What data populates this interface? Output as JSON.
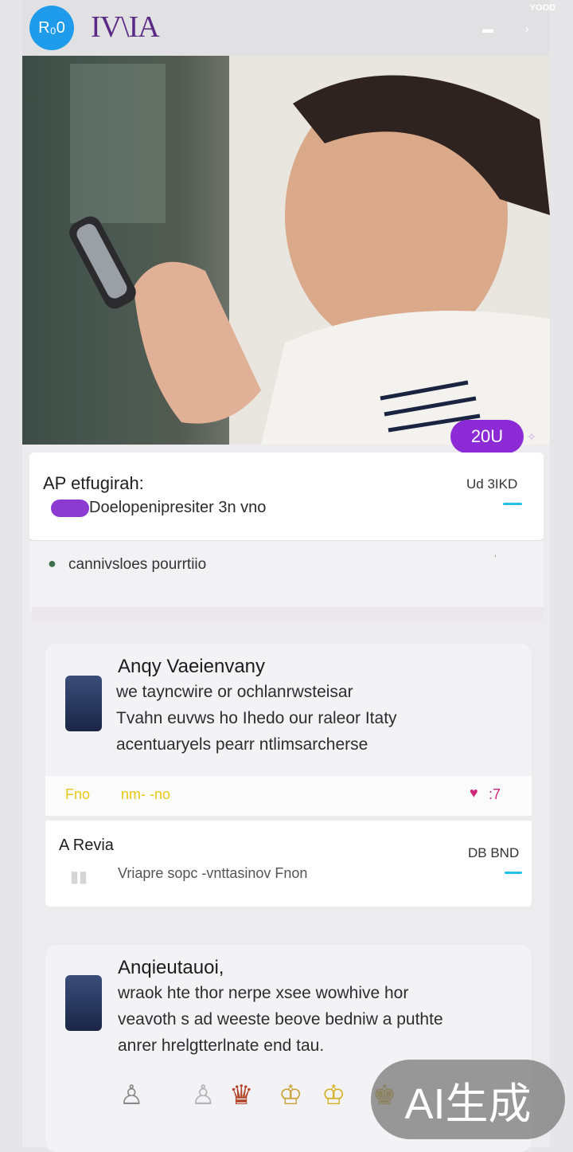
{
  "header": {
    "avatar_text": "R₀0",
    "brand": "IV\\IA",
    "status_right": "YOOD"
  },
  "hero": {
    "badge": "20U"
  },
  "card_one": {
    "title": "AP  etfugirah:",
    "subtitle": "Doelopenipresiter 3n vno",
    "right_label": "Ud 3IKD",
    "detail": "cannivsloes pourrtiio"
  },
  "card_two": {
    "title": "Anqy  Vaeienvany",
    "body_lines": [
      "we tayncwire or ochlanrwsteisar",
      "Tvahn euvws ho Ihedo our raleor Itaty",
      "acentuaryels pearr ntlimsarcherse"
    ],
    "metric_left_a": "Fno",
    "metric_left_b": "nm- -no",
    "metric_right": ":7"
  },
  "card_three": {
    "title": "A  Revia",
    "right_label": "DB BND",
    "subtitle": "Vriapre sopc -vnttasinov Fnon"
  },
  "card_four": {
    "title": "Anqieutauoi,",
    "body_lines": [
      "wraok hte thor nerpe xsee wowhive hor",
      "veavoth s ad weeste beove bedniw a puthte",
      "anrer hrelgtterlnate end tau."
    ]
  },
  "watermark": "AI生成",
  "colors": {
    "accent_purple": "#8c2bd6",
    "accent_cyan": "#22c1e8",
    "avatar_blue": "#1e9bea",
    "metric_yellow": "#e8c81a",
    "metric_pink": "#d0287a"
  }
}
